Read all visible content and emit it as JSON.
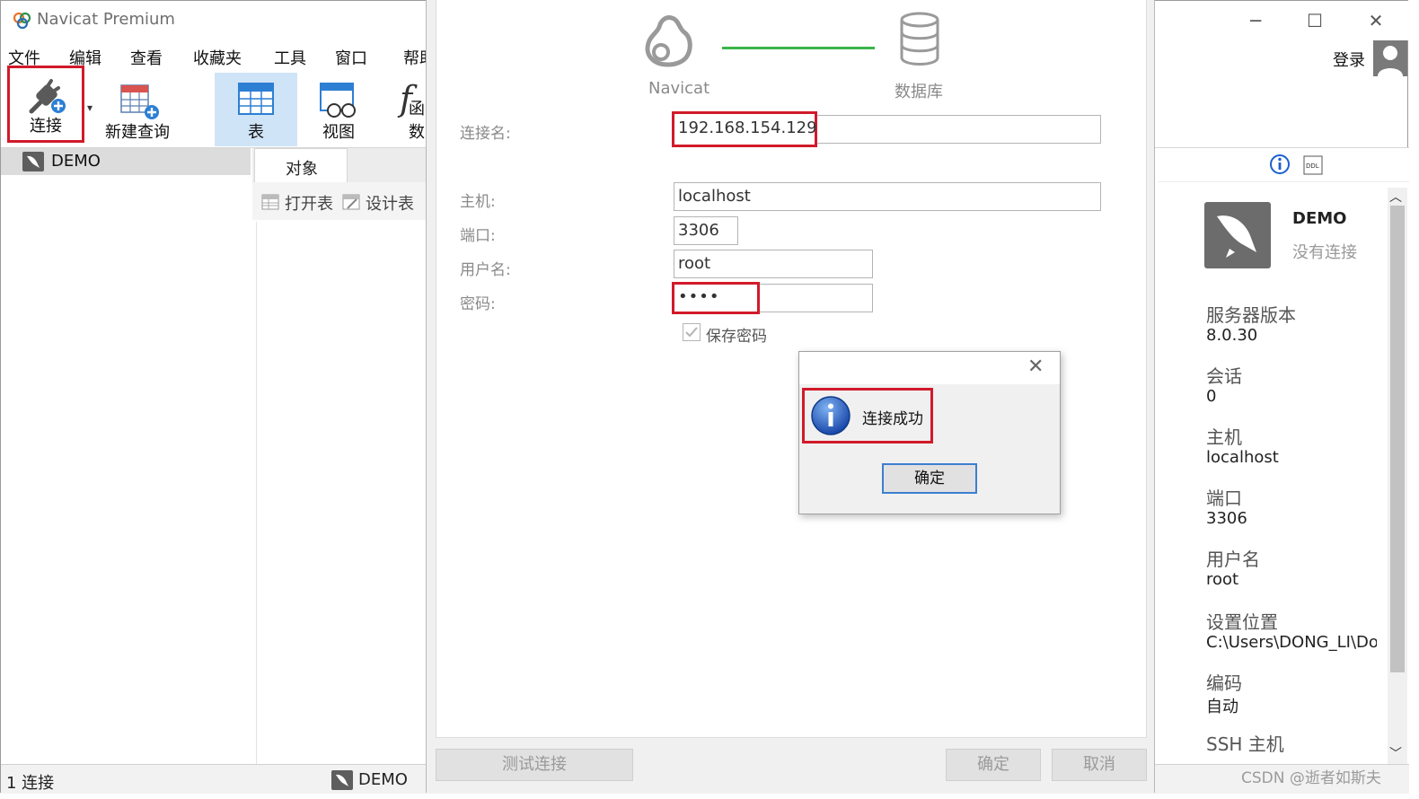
{
  "window": {
    "title": "Navicat Premium",
    "controls": {
      "minimize": "─",
      "maximize": "☐",
      "close": "✕"
    }
  },
  "menu": [
    "文件",
    "编辑",
    "查看",
    "收藏夹",
    "工具",
    "窗口",
    "帮助"
  ],
  "toolbar": {
    "connect": "连接",
    "new_query": "新建查询",
    "table": "表",
    "view": "视图",
    "function": "函数",
    "login": "登录"
  },
  "nav": {
    "items": [
      {
        "label": "DEMO"
      }
    ]
  },
  "objects": {
    "tab": "对象",
    "open_table": "打开表",
    "design_table": "设计表"
  },
  "status": {
    "connections": "1 连接",
    "current": "DEMO"
  },
  "info_panel": {
    "name": "DEMO",
    "status": "没有连接",
    "fields": [
      {
        "label": "服务器版本",
        "value": "8.0.30"
      },
      {
        "label": "会话",
        "value": "0"
      },
      {
        "label": "主机",
        "value": "localhost"
      },
      {
        "label": "端口",
        "value": "3306"
      },
      {
        "label": "用户名",
        "value": "root"
      },
      {
        "label": "设置位置",
        "value": "C:\\Users\\DONG_LI\\Doc"
      },
      {
        "label": "编码",
        "value": "自动"
      },
      {
        "label": "SSH 主机",
        "value": ""
      }
    ]
  },
  "dialog": {
    "navicat_label": "Navicat",
    "db_label": "数据库",
    "conn_name_label": "连接名:",
    "conn_name_value": "192.168.154.129",
    "host_label": "主机:",
    "host_value": "localhost",
    "port_label": "端口:",
    "port_value": "3306",
    "user_label": "用户名:",
    "user_value": "root",
    "password_label": "密码:",
    "password_value": "••••",
    "save_password": "保存密码",
    "test_button": "测试连接",
    "ok_button": "确定",
    "cancel_button": "取消"
  },
  "message_box": {
    "text": "连接成功",
    "ok": "确定",
    "close": "✕"
  },
  "watermark": "CSDN @逝者如斯夫",
  "colors": {
    "highlight_red": "#d11a2a",
    "success_green": "#3bb54a",
    "info_blue": "#1a5fd0"
  }
}
